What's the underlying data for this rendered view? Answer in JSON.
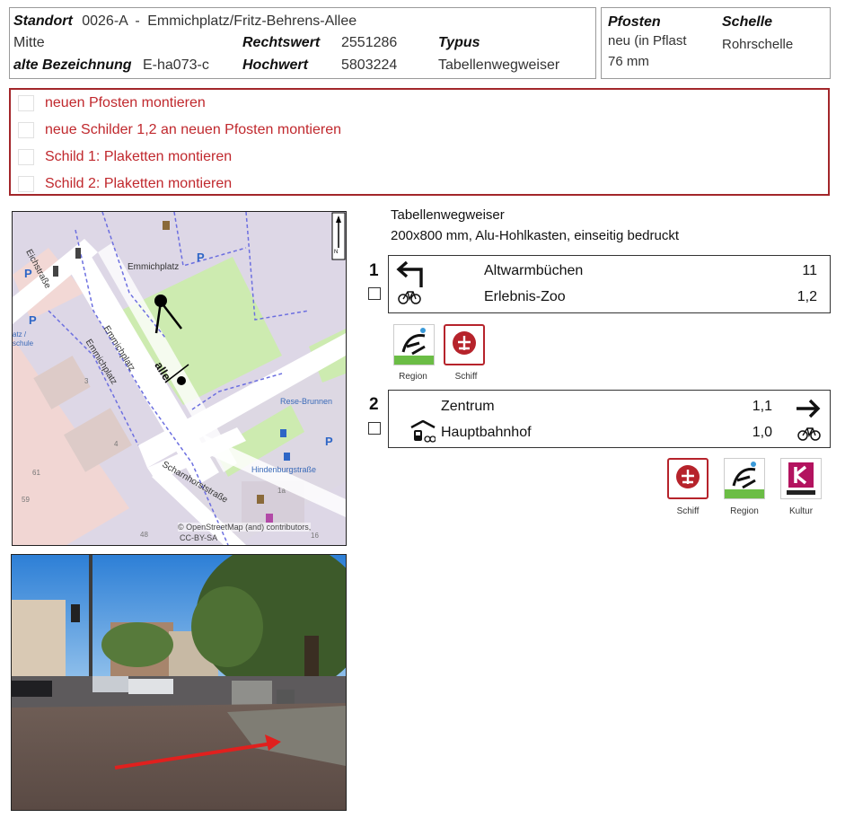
{
  "header": {
    "standort_label": "Standort",
    "standort_id": "0026-A",
    "standort_sep": "-",
    "standort_name": "Emmichplatz/Fritz-Behrens-Allee",
    "district": "Mitte",
    "rechtswert_label": "Rechtswert",
    "rechtswert": "2551286",
    "typus_label": "Typus",
    "alte_label": "alte Bezeichnung",
    "alte_value": "E-ha073-c",
    "hochwert_label": "Hochwert",
    "hochwert": "5803224",
    "typus_value": "Tabellenwegweiser"
  },
  "header_right": {
    "pfosten_label": "Pfosten",
    "pfosten_value_1": "neu (in Pflast",
    "pfosten_value_2": "76 mm",
    "schelle_label": "Schelle",
    "schelle_value": "Rohrschelle"
  },
  "tasks": [
    {
      "label": "neuen Pfosten montieren"
    },
    {
      "label": "neue Schilder 1,2 an neuen Pfosten montieren"
    },
    {
      "label": "Schild 1: Plaketten montieren"
    },
    {
      "label": "Schild 2: Plaketten montieren"
    }
  ],
  "map": {
    "street_eichstrasse": "Eichstraße",
    "place_emmichplatz": "Emmichplatz",
    "street_emmichplatz_1": "Emmichplatz",
    "street_emmichplatz_2": "Emmichplatz",
    "street_allee": "alle",
    "street_scharnhorst": "Scharnhorststraße",
    "poi_brunnen": "Rese-Brunnen",
    "poi_hindenburg": "Hindenburgstraße",
    "poi_schule": "atz / schule",
    "house_3": "3",
    "house_4": "4",
    "house_61": "61",
    "house_59": "59",
    "house_48": "48",
    "house_1a": "1a",
    "house_16": "16",
    "attribution_1": "© OpenStreetMap (and) contributors,",
    "attribution_2": "CC-BY-SA",
    "north": "N"
  },
  "signinfo": {
    "title": "Tabellenwegweiser",
    "spec": "200x800 mm, Alu-Hohlkasten, einseitig bedruckt"
  },
  "sign1": {
    "number": "1",
    "rows": [
      {
        "dest": "Altwarmbüchen",
        "km": "11"
      },
      {
        "dest": "Erlebnis-Zoo",
        "km": "1,2"
      }
    ],
    "plaques": [
      {
        "caption": "Region"
      },
      {
        "caption": "Schiff"
      }
    ]
  },
  "sign2": {
    "number": "2",
    "rows": [
      {
        "dest": "Zentrum",
        "km": "1,1"
      },
      {
        "dest": "Hauptbahnhof",
        "km": "1,0"
      }
    ],
    "plaques": [
      {
        "caption": "Schiff"
      },
      {
        "caption": "Region"
      },
      {
        "caption": "Kultur"
      }
    ]
  },
  "colors": {
    "task_red": "#c0282d",
    "schiff_red": "#b6232b",
    "region_green": "#6bbd45",
    "kultur_magenta": "#b3135f"
  }
}
